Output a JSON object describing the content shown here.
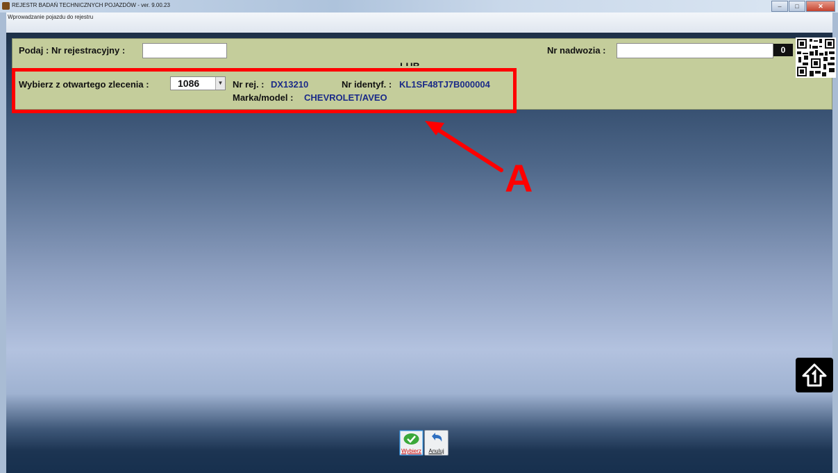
{
  "window": {
    "title": "REJESTR BADAŃ TECHNICZNYCH POJAZDÓW -  ver. 9.00.23",
    "subtitle": "Wprowadzanie pojazdu do rejestru",
    "buttons": [
      "minimize-icon",
      "maximize-icon",
      "close-icon"
    ]
  },
  "form": {
    "reg_label": "Podaj : Nr rejestracyjny :",
    "reg_value": "",
    "lub_label": "LUB",
    "vin_label": "Nr nadwozia :",
    "vin_value": "",
    "counter": "0",
    "order_label": "Wybierz z otwartego zlecenia :",
    "order_value": "1086",
    "nr_rej_label": "Nr rej. :",
    "nr_rej_value": "DX13210",
    "nr_identyf_label": "Nr identyf. :",
    "nr_identyf_value": "KL1SF48TJ7B000004",
    "make_label": "Marka/model :",
    "make_value": "CHEVROLET/AVEO"
  },
  "annotation": {
    "letter": "A",
    "color": "#ff0000"
  },
  "actions": {
    "select_label": "Wybierz",
    "cancel_label": "Anuluj"
  },
  "colors": {
    "panel": "#c4cd9b",
    "value_text": "#1a2a88"
  }
}
